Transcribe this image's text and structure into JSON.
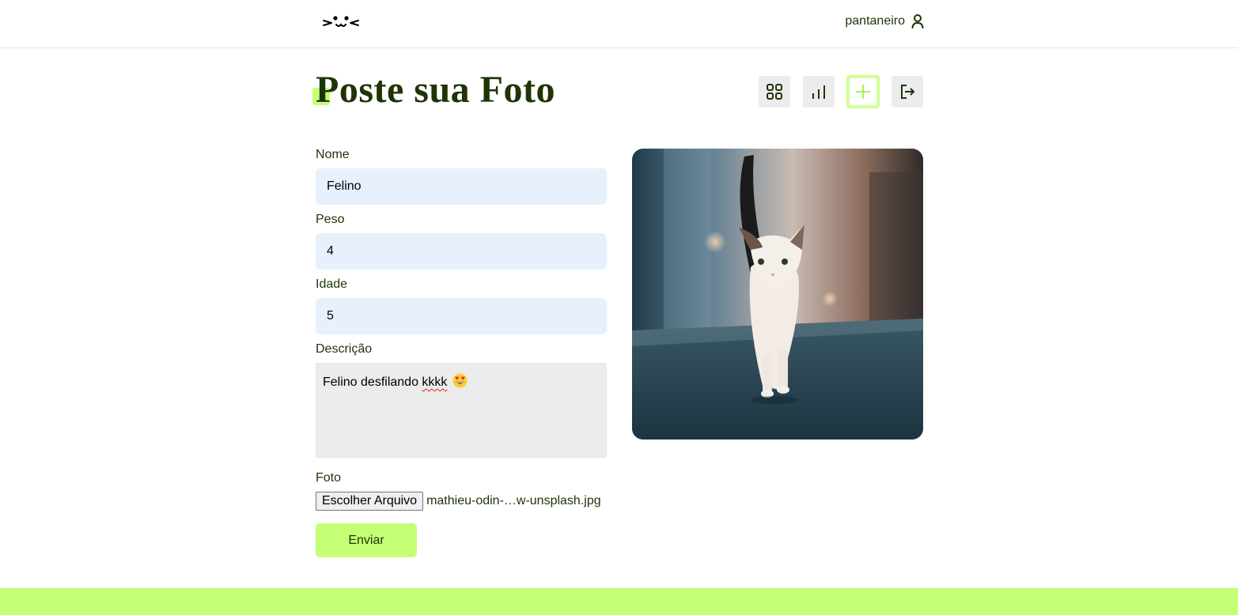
{
  "header": {
    "username": "pantaneiro",
    "logo_icon": "cat-face-logo",
    "user_icon": "user-icon"
  },
  "page": {
    "title": "Poste sua Foto"
  },
  "nav": [
    {
      "icon": "grid-icon"
    },
    {
      "icon": "bar-chart-icon"
    },
    {
      "icon": "plus-icon",
      "active": true
    },
    {
      "icon": "logout-icon"
    }
  ],
  "form": {
    "nome_label": "Nome",
    "nome_value": "Felino",
    "peso_label": "Peso",
    "peso_value": "4",
    "idade_label": "Idade",
    "idade_value": "5",
    "descricao_label": "Descrição",
    "descricao_prefix": "Felino desfilando ",
    "descricao_misspelled": "kkkk",
    "descricao_emoji_icon": "heart-eyes-emoji-icon",
    "foto_label": "Foto",
    "file_button_label": "Escolher Arquivo",
    "file_name": "mathieu-odin-…w-unsplash.jpg",
    "submit_label": "Enviar"
  },
  "colors": {
    "accent": "#c4ff74",
    "text": "#1e3405",
    "input_bg": "#e8f0fe",
    "button_bg": "#ececec"
  }
}
